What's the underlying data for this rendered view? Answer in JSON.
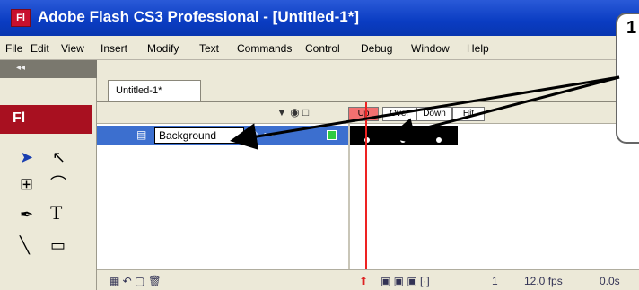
{
  "window": {
    "app_icon_text": "Fl",
    "title": "Adobe Flash CS3 Professional - [Untitled-1*]"
  },
  "menu": [
    "File",
    "Edit",
    "View",
    "Insert",
    "Modify",
    "Text",
    "Commands",
    "Control",
    "Debug",
    "Window",
    "Help"
  ],
  "toolbox": {
    "collapse_glyph": "◂◂",
    "badge": "Fl"
  },
  "document": {
    "tab_label": "Untitled-1*"
  },
  "timeline": {
    "header_icons": "▼ ◉ □",
    "frame_labels": [
      "Up",
      "Over",
      "Down",
      "Hit"
    ],
    "layer": {
      "name": "Background",
      "controls": "✎ • •"
    },
    "status": {
      "current_frame": "1",
      "fps": "12.0 fps",
      "time": "0.0s"
    }
  },
  "callout": {
    "number": "1"
  },
  "colors": {
    "title_bar": "#0a3cc2",
    "layer_selected": "#3c6fcf",
    "playhead": "#e22222",
    "fl_badge": "#a81020"
  }
}
